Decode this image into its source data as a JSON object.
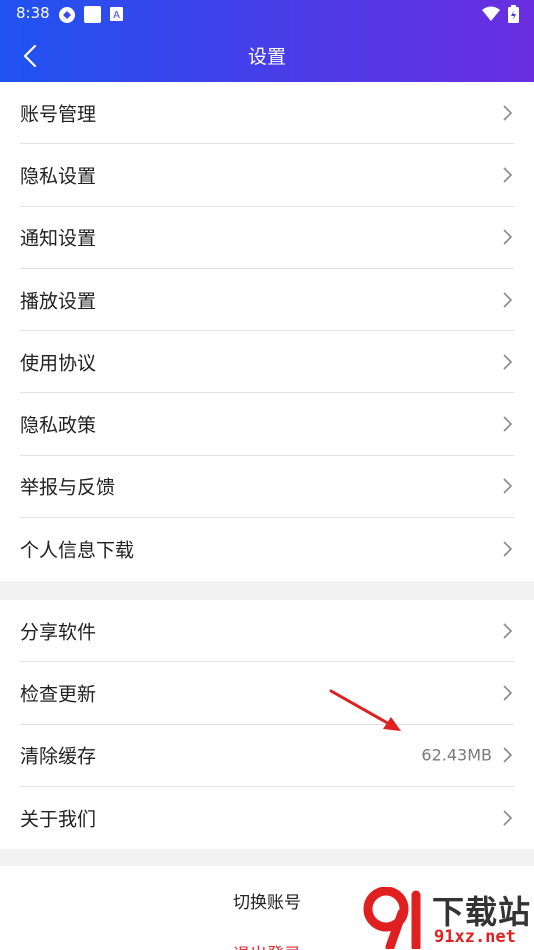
{
  "status_bar": {
    "time": "8:38",
    "icons": [
      "sync-icon",
      "square-icon",
      "a-badge-icon",
      "wifi-icon",
      "battery-icon"
    ]
  },
  "header": {
    "title": "设置",
    "back_icon": "chevron-left-icon"
  },
  "group1": [
    {
      "label": "账号管理"
    },
    {
      "label": "隐私设置"
    },
    {
      "label": "通知设置"
    },
    {
      "label": "播放设置"
    },
    {
      "label": "使用协议"
    },
    {
      "label": "隐私政策"
    },
    {
      "label": "举报与反馈"
    },
    {
      "label": "个人信息下载"
    }
  ],
  "group2": [
    {
      "label": "分享软件"
    },
    {
      "label": "检查更新"
    },
    {
      "label": "清除缓存",
      "value": "62.43MB"
    },
    {
      "label": "关于我们"
    }
  ],
  "actions": {
    "switch_account": "切换账号",
    "logout": "退出登录"
  },
  "watermark": {
    "logo_text": "91",
    "site_name": "下载站",
    "url": "91xz.net"
  },
  "colors": {
    "header_start": "#1f53f0",
    "header_end": "#6a2ee0",
    "logout": "#e03030",
    "annotation": "#e02020"
  }
}
